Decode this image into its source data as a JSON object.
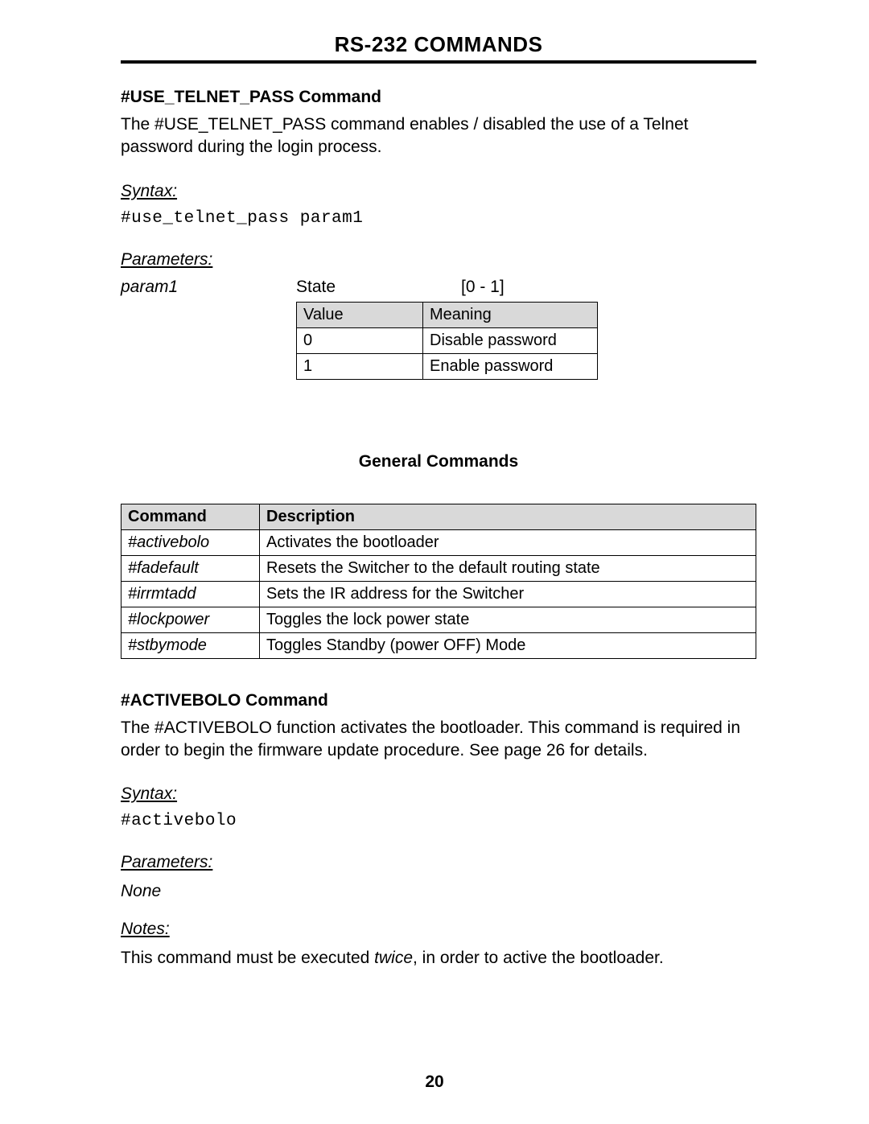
{
  "page_title": "RS-232 COMMANDS",
  "cmd1": {
    "heading": "#USE_TELNET_PASS Command",
    "description": "The #USE_TELNET_PASS command enables / disabled the use of a Telnet password during the login process.",
    "syntax_label": "Syntax:",
    "syntax_code": "#use_telnet_pass param1",
    "parameters_label": "Parameters:",
    "param_name": "param1",
    "param_type": "State",
    "param_range": "[0 - 1]",
    "value_table": {
      "headers": {
        "value": "Value",
        "meaning": "Meaning"
      },
      "rows": [
        {
          "value": "0",
          "meaning": "Disable password"
        },
        {
          "value": "1",
          "meaning": "Enable password"
        }
      ]
    }
  },
  "general_heading": "General Commands",
  "cmd_table": {
    "headers": {
      "command": "Command",
      "description": "Description"
    },
    "rows": [
      {
        "command": "#activebolo",
        "description": "Activates the bootloader"
      },
      {
        "command": "#fadefault",
        "description": "Resets the Switcher to the default routing state"
      },
      {
        "command": "#irrmtadd",
        "description": "Sets the IR address for the Switcher"
      },
      {
        "command": "#lockpower",
        "description": "Toggles the lock power state"
      },
      {
        "command": "#stbymode",
        "description": "Toggles Standby (power OFF) Mode"
      }
    ]
  },
  "cmd2": {
    "heading": "#ACTIVEBOLO Command",
    "description": "The #ACTIVEBOLO function activates the bootloader.  This command is required in order to begin the firmware update procedure.  See page 26 for details.",
    "syntax_label": "Syntax:",
    "syntax_code": "#activebolo",
    "parameters_label": "Parameters:",
    "parameters_value": "None",
    "notes_label": "Notes:",
    "notes_pre": "This command must be executed ",
    "notes_em": "twice",
    "notes_post": ", in order to active the bootloader."
  },
  "page_number": "20"
}
